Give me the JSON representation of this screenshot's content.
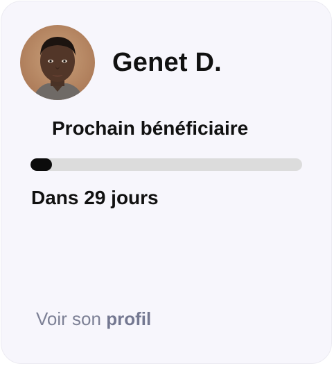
{
  "profile": {
    "name": "Genet D."
  },
  "beneficiary": {
    "label": "Prochain bénéficiaire",
    "progress_fraction": 0.08,
    "countdown": "Dans 29 jours"
  },
  "link": {
    "prefix": "Voir son",
    "emphasis": "profil"
  },
  "colors": {
    "card_background": "#f7f6fc",
    "progress_track": "#dcdcdc",
    "progress_fill": "#0c0c0c",
    "link_text": "#7d8196"
  },
  "icons": {
    "avatar": "user-photo"
  }
}
